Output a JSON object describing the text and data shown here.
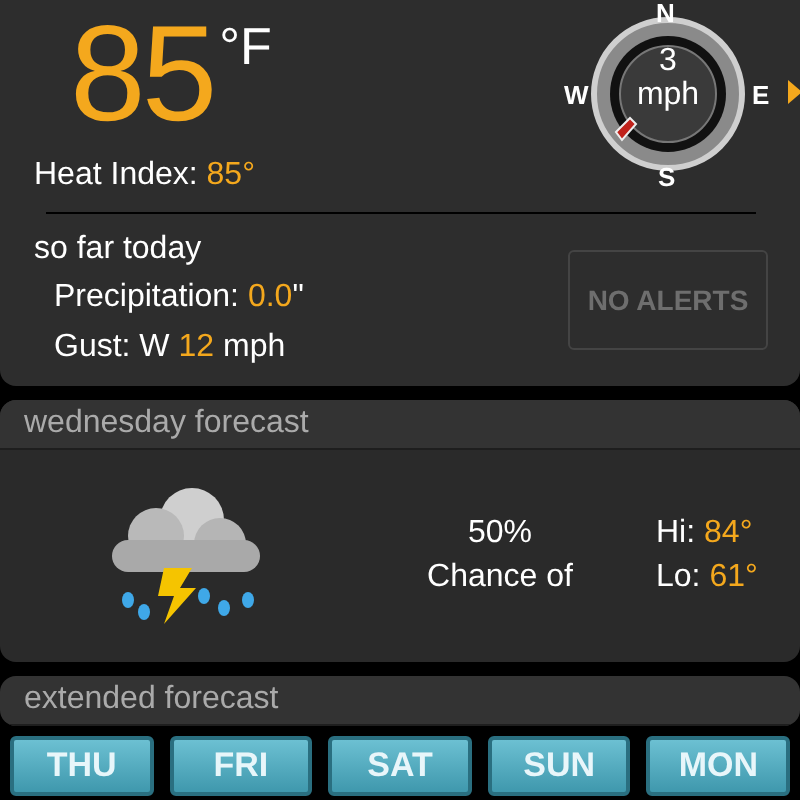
{
  "current": {
    "temperature": "85",
    "unit": "°F",
    "heat_index_label": "Heat Index:",
    "heat_index_value": "85°"
  },
  "wind": {
    "speed": "3",
    "unit": "mph",
    "north": "N",
    "west": "W",
    "east": "E",
    "south": "S"
  },
  "so_far_today": {
    "title": "so far today",
    "rows": [
      {
        "label": "Precipitation:",
        "value": "0.0",
        "suffix": "\""
      },
      {
        "label": "Gust: W",
        "value": "12",
        "suffix": "mph"
      }
    ]
  },
  "alerts_button": "NO ALERTS",
  "day_forecast": {
    "title": "wednesday forecast",
    "chance": "50%",
    "chance_label": "Chance of",
    "hi_label": "Hi:",
    "hi": "84°",
    "lo_label": "Lo:",
    "lo": "61°"
  },
  "extended_forecast": {
    "title": "extended forecast",
    "days": [
      "THU",
      "FRI",
      "SAT",
      "SUN",
      "MON"
    ]
  }
}
